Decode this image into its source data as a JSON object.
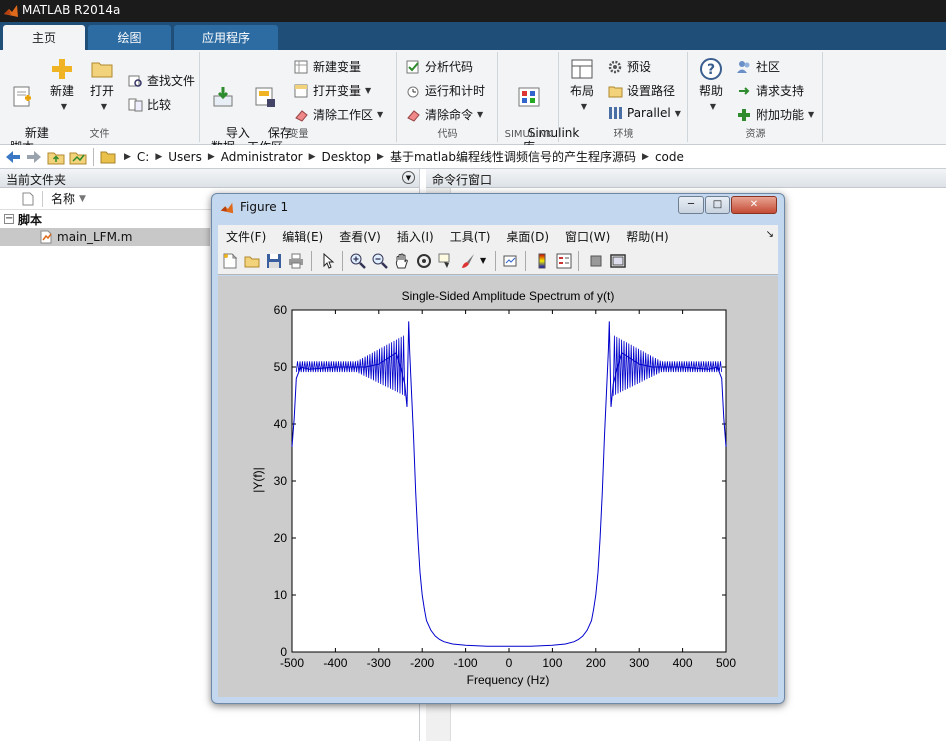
{
  "window": {
    "title": "MATLAB R2014a"
  },
  "tabs": [
    {
      "label": "主页"
    },
    {
      "label": "绘图"
    },
    {
      "label": "应用程序"
    }
  ],
  "ribbon": {
    "file": {
      "label": "文件",
      "new_script": "新建\n脚本",
      "new": "新建",
      "open": "打开",
      "find_files": "查找文件",
      "compare": "比较"
    },
    "variable": {
      "label": "变量",
      "import_data": "导入\n数据",
      "save_workspace": "保存\n工作区",
      "new_variable": "新建变量",
      "open_variable": "打开变量",
      "clear_workspace": "清除工作区"
    },
    "code": {
      "label": "代码",
      "analyze_code": "分析代码",
      "run_and_time": "运行和计时",
      "clear_commands": "清除命令"
    },
    "simulink": {
      "label": "SIMULINK",
      "simulink_library": "Simulink\n库"
    },
    "environment": {
      "label": "环境",
      "layout": "布局",
      "preferences": "预设",
      "set_path": "设置路径",
      "parallel": "Parallel"
    },
    "resources": {
      "label": "资源",
      "help": "帮助",
      "community": "社区",
      "request_support": "请求支持",
      "add_ons": "附加功能"
    }
  },
  "address": {
    "crumbs": [
      "C:",
      "Users",
      "Administrator",
      "Desktop",
      "基于matlab编程线性调频信号的产生程序源码",
      "code"
    ]
  },
  "current_folder": {
    "title": "当前文件夹",
    "column_name": "名称",
    "group": "脚本",
    "file": "main_LFM.m"
  },
  "command_window": {
    "title": "命令行窗口"
  },
  "figure": {
    "title": "Figure 1",
    "menu": [
      "文件(F)",
      "编辑(E)",
      "查看(V)",
      "插入(I)",
      "工具(T)",
      "桌面(D)",
      "窗口(W)",
      "帮助(H)"
    ]
  },
  "chart_data": {
    "type": "line",
    "title": "Single-Sided Amplitude Spectrum of y(t)",
    "xlabel": "Frequency (Hz)",
    "ylabel": "|Y(f)|",
    "xlim": [
      -500,
      500
    ],
    "ylim": [
      0,
      60
    ],
    "xticks": [
      -500,
      -400,
      -300,
      -200,
      -100,
      0,
      100,
      200,
      300,
      400,
      500
    ],
    "yticks": [
      0,
      10,
      20,
      30,
      40,
      50,
      60
    ],
    "grid": false,
    "series": [
      {
        "color": "#0000cc",
        "x": [
          -500,
          -495,
          -490,
          -480,
          -460,
          -400,
          -330,
          -300,
          -280,
          -260,
          -250,
          -240,
          -235,
          -231,
          -229,
          -225,
          -220,
          -215,
          -210,
          -205,
          -200,
          -195,
          -190,
          -180,
          -170,
          -160,
          -150,
          -130,
          -100,
          -50,
          0,
          50,
          100,
          130,
          150,
          160,
          170,
          180,
          190,
          195,
          200,
          205,
          210,
          215,
          220,
          225,
          229,
          231,
          235,
          240,
          250,
          260,
          280,
          300,
          330,
          400,
          460,
          480,
          490,
          495,
          500
        ],
        "y": [
          36,
          41,
          48,
          50,
          49.6,
          50,
          50,
          50.5,
          51.5,
          52.5,
          50,
          47,
          43,
          58,
          53,
          46,
          38,
          28,
          20,
          14,
          10,
          7.5,
          5.5,
          3.8,
          2.8,
          2.2,
          1.8,
          1.4,
          1.2,
          1.0,
          1.0,
          1.0,
          1.2,
          1.4,
          1.8,
          2.2,
          2.8,
          3.8,
          5.5,
          7.5,
          10,
          14,
          20,
          28,
          38,
          46,
          53,
          58,
          43,
          47,
          50,
          52.5,
          51.5,
          50.5,
          50,
          50,
          49.6,
          50,
          48,
          41,
          36
        ]
      }
    ]
  }
}
